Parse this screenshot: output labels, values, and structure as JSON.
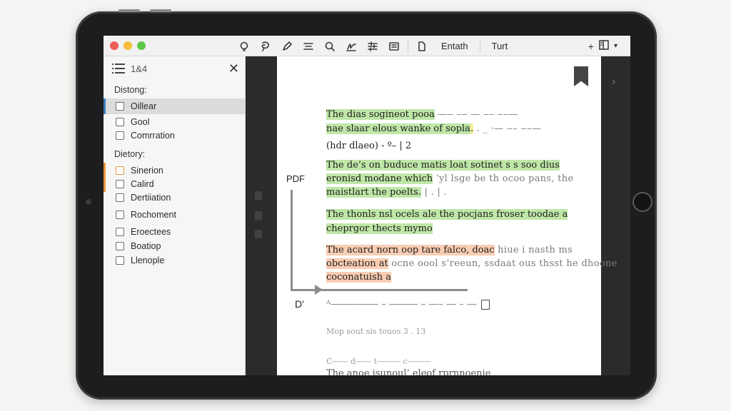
{
  "toolbar": {
    "text_left": "Entath",
    "text_right": "Turt",
    "right_icons": [
      "plus-icon",
      "sidebar-icon"
    ],
    "tool_icons": [
      "lightbulb-icon",
      "lasso-icon",
      "pen-icon",
      "text-lines-icon",
      "search-icon",
      "signature-icon",
      "adjust-icon",
      "form-icon",
      "document-icon"
    ]
  },
  "sidebar": {
    "count": "1&4",
    "section1": "Distong:",
    "section2": "Dietory:",
    "items1": [
      {
        "label": "Oillear",
        "selected": true,
        "accent": "#3c7dc2"
      },
      {
        "label": "Gool"
      },
      {
        "label": "Comrration"
      }
    ],
    "items2": [
      {
        "label": "Sinerion",
        "accent": "#e8963a"
      },
      {
        "label": "Calird"
      },
      {
        "label": "Dertiiation"
      },
      {
        "label": "Rochoment"
      },
      {
        "label": "Eroectees"
      },
      {
        "label": "Boatiop"
      },
      {
        "label": "Llenople"
      }
    ]
  },
  "doc": {
    "pdf_label": "PDF",
    "d_label": "D'",
    "lines": [
      {
        "hl": "The dias sogineot pooa",
        "rest": " ―‒ –‒ — ‒– ‒–—",
        "color": "green"
      },
      {
        "hl": "nae slaar elous wanke of sopla",
        "hl2": ".",
        "rest": " . _ ·— ‒– ‒–—",
        "color": "green"
      },
      {
        "plain": "(hdr dlaeo) -  º– |  2"
      },
      {
        "hl": "The de’s on buduce matis loat sotinet s s soo dius",
        "color": "green"
      },
      {
        "hl": "eronisd modane which",
        "rest": " ‘yl lsge be th ocoo pans, the",
        "color": "green"
      },
      {
        "hl": "maistlart the poelts.",
        "rest": "         |           .        |  .",
        "color": "green"
      },
      {
        "hl": "The thonls nsl ocels ale the pocjans froser toodae a",
        "color": "green"
      },
      {
        "hl": "cheprgor thects mymo",
        "color": "green"
      },
      {
        "hl": "The acard norn oop tare falco, doac",
        "rest": " hiue i nasth ms",
        "color": "orange"
      },
      {
        "hl": "obcteation at",
        "rest": " ocne oool s’reeun, ssdaat ous thsst he dhoone",
        "color": "orange"
      },
      {
        "hl": "coconatuish a",
        "color": "orange"
      },
      {
        "plain": "ᴬ――――― – ――― – ―– ― – ―"
      },
      {
        "plain": "Mop sout sis touos  3  .  13"
      },
      {
        "plain": "C―― d―― t――― c―――"
      },
      {
        "plain": "The anoe isunoul’ eleof rprnnoenie"
      }
    ]
  }
}
